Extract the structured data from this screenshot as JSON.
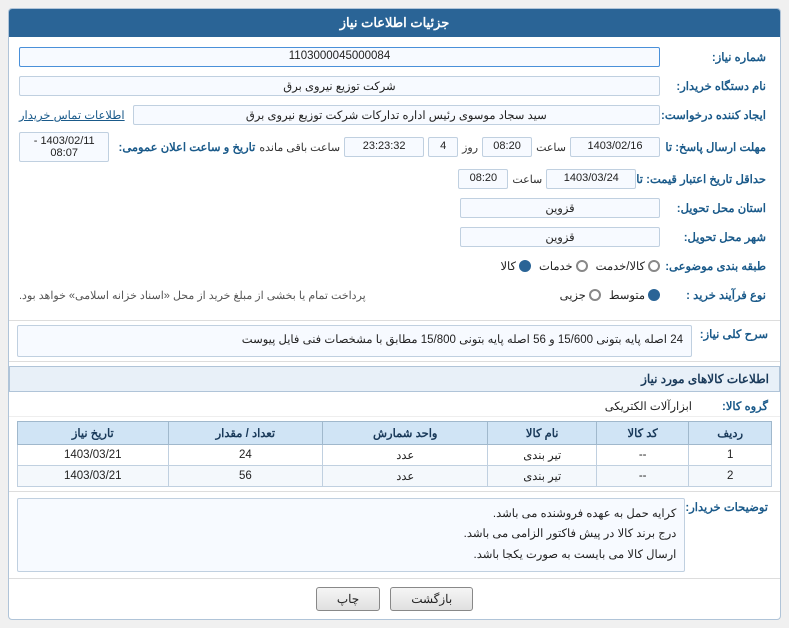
{
  "header": {
    "title": "جزئیات اطلاعات نیاز"
  },
  "fields": {
    "shmare_niaz_label": "شماره نیاز:",
    "shmare_niaz_value": "1103000045000084",
    "nam_dastgah_label": "نام دستگاه خریدار:",
    "nam_dastgah_value": "شرکت توزیع نیروی برق",
    "ijad_konande_label": "ایجاد کننده درخواست:",
    "ijad_konande_value": "سید سجاد موسوی رئیس اداره تدارکات شرکت توزیع نیروی برق",
    "ettelaat_tamas_label": "اطلاعات تماس خریدار",
    "mohlat_ersal_label": "مهلت ارسال پاسخ: تا",
    "date1": "1403/02/16",
    "saat1": "08:20",
    "roz": "4",
    "baqi_mande": "23:23:32",
    "baqi_mande_label": "ساعت باقی مانده",
    "tarikh_va_saat_label": "تاریخ و ساعت اعلان عمومی:",
    "tarikh_va_saat_value": "1403/02/11 - 08:07",
    "haddeaghal_tarikh_label": "حداقل تاریخ اعتبار قیمت: تا",
    "date2": "1403/03/24",
    "saat2": "08:20",
    "ostan_label": "استان محل تحویل:",
    "ostan_value": "قزوین",
    "shahr_label": "شهر محل تحویل:",
    "shahr_value": "قزوین",
    "tabaghe_label": "طبقه بندی موضوعی:",
    "radio_kala": "کالا",
    "radio_khadamat": "خدمات",
    "radio_kala_khadamat": "کالا/خدمت",
    "nav_farayand_label": "نوع فرآیند خرید :",
    "radio_jozyi": "جزیی",
    "radio_motavasset": "متوسط",
    "farayand_notice": "پرداخت تمام یا بخشی از مبلغ خرید از محل «اسناد خزانه اسلامی» خواهد بود.",
    "sarh_koli_label": "سرح کلی نیاز:",
    "sarh_koli_value": "24 اصله پایه بتونی 15/600 و 56 اصله پایه بتونی 15/800 مطابق با مشخصات فنی فایل پیوست",
    "etelaat_kalaها_label": "اطلاعات کالاهای مورد نیاز",
    "group_kala_label": "گروه کالا:",
    "group_kala_value": "ابزارآلات الکتریکی",
    "table": {
      "headers": [
        "ردیف",
        "کد کالا",
        "نام کالا",
        "واحد شمارش",
        "تعداد / مقدار",
        "تاریخ نیاز"
      ],
      "rows": [
        [
          "1",
          "--",
          "تیر بندی",
          "عدد",
          "24",
          "1403/03/21"
        ],
        [
          "2",
          "--",
          "تیر بندی",
          "عدد",
          "56",
          "1403/03/21"
        ]
      ]
    },
    "buyer_notes_label": "توضیحات خریدار:",
    "buyer_notes_lines": [
      "کرایه حمل به عهده فروشنده می باشد.",
      "درج برند کالا در پیش فاکتور الزامی می باشد.",
      "ارسال کالا می بایست به صورت یکجا باشد."
    ],
    "btn_print": "چاپ",
    "btn_back": "بازگشت"
  }
}
